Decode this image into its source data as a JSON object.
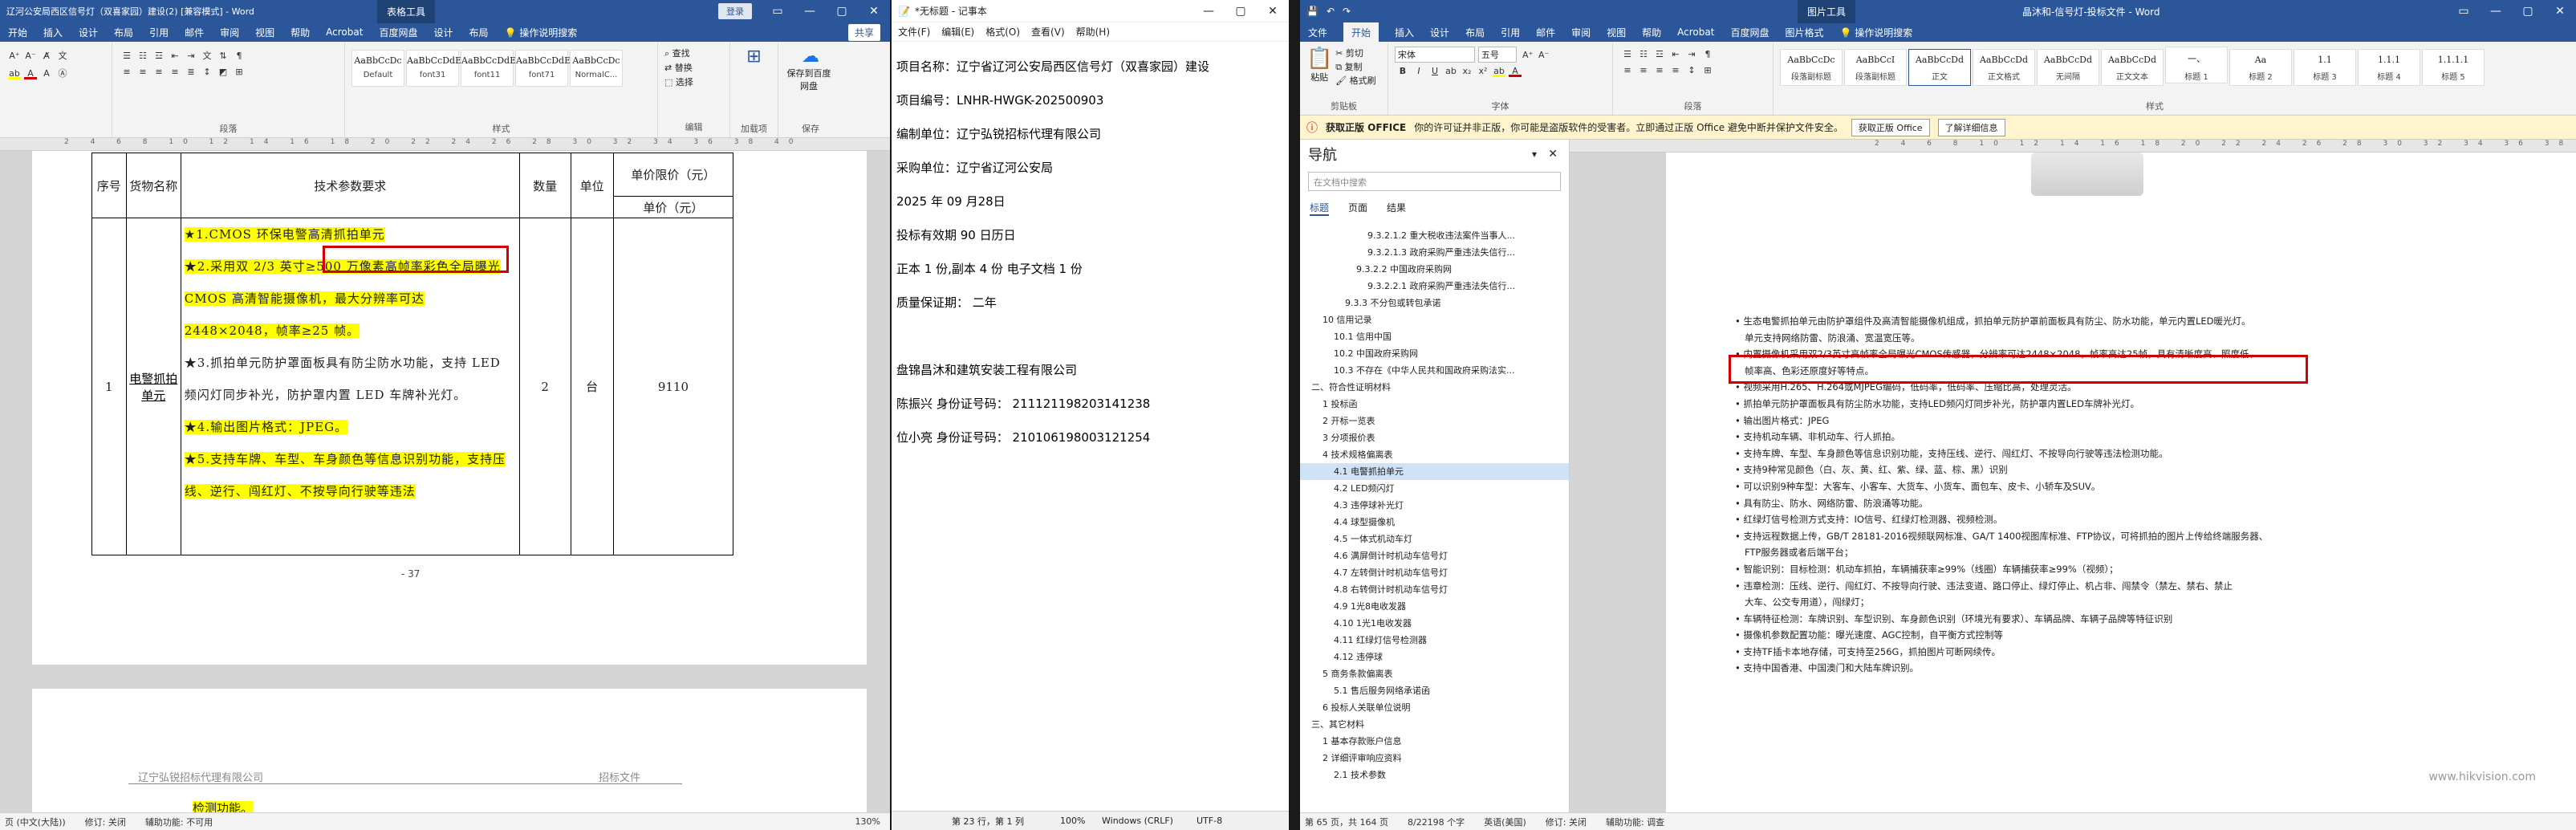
{
  "left_word": {
    "title": "辽河公安局西区信号灯（双喜家园）建设(2)  [兼容模式] - Word",
    "context_tab": "表格工具",
    "login": "登录",
    "tabs": [
      "开始",
      "插入",
      "设计",
      "布局",
      "引用",
      "邮件",
      "审阅",
      "视图",
      "帮助",
      "Acrobat",
      "百度网盘",
      "设计",
      "布局",
      "操作说明搜索"
    ],
    "ribbon_groups": [
      "段落",
      "样式",
      "编辑",
      "加载项",
      "保存"
    ],
    "styles": [
      {
        "preview": "AaBbCcDc",
        "name": "Default"
      },
      {
        "preview": "AaBbCcDdE",
        "name": "font31"
      },
      {
        "preview": "AaBbCcDdE",
        "name": "font11"
      },
      {
        "preview": "AaBbCcDdE",
        "name": "font71"
      },
      {
        "preview": "AaBbCcDc",
        "name": "NormalC..."
      }
    ],
    "edit_items": [
      "查找",
      "替换",
      "选择"
    ],
    "addins_label": "加载项",
    "save_label": "保存到百度网盘",
    "share": "共享",
    "table": {
      "headers": [
        "序号",
        "货物名称",
        "技术参数要求",
        "数量",
        "单位",
        "单价限价（元）",
        "单价（元）"
      ],
      "row_no": "1",
      "item_name": "电警抓拍单元",
      "qty": "2",
      "unit": "台",
      "price": "9110",
      "paras": [
        "★1.CMOS 环保电警高清抓拍单元",
        "★2.采用双 2/3 英寸≥500 万像素高帧率彩色全局曝光 CMOS 高清智能摄像机，最大分辨率可达 2448×2048，帧率≥25 帧。",
        "★3.抓拍单元防护罩面板具有防尘防水功能，支持 LED 频闪灯同步补光，防护罩内置 LED 车牌补光灯。",
        "★4.输出图片格式：JPEG。",
        "★5.支持车牌、车型、车身颜色等信息识别功能，支持压线、逆行、闯红灯、不按导向行驶等违法"
      ]
    },
    "page_number": "- 37",
    "header_company": "辽宁弘锐招标代理有限公司",
    "header_right": "招标文件",
    "bottom_text": "检测功能。",
    "status": {
      "pages": "页 (中文(大陆))",
      "revisions": "修订: 关闭",
      "accessibility": "辅助功能: 不可用",
      "zoom": "130%"
    }
  },
  "notepad": {
    "title": "*无标题 - 记事本",
    "menu": [
      "文件(F)",
      "编辑(E)",
      "格式(O)",
      "查看(V)",
      "帮助(H)"
    ],
    "lines": [
      "项目名称：辽宁省辽河公安局西区信号灯（双喜家园）建设",
      "项目编号：LNHR-HWGK-202500903",
      "编制单位：辽宁弘锐招标代理有限公司",
      "采购单位：辽宁省辽河公安局",
      "2025 年 09 月28日",
      "投标有效期 90 日历日",
      "正本 1 份,副本 4 份  电子文档  1  份",
      "质量保证期： 二年",
      "",
      "盘锦昌沐和建筑安装工程有限公司",
      "陈振兴  身份证号码：  211121198203141238",
      "位小亮  身份证号码：  210106198003121254"
    ],
    "status": {
      "pos": "第 23 行，第 1 列",
      "zoom": "100%",
      "eol": "Windows (CRLF)",
      "enc": "UTF-8"
    }
  },
  "right_word": {
    "title": "晶沐和-信号灯-投标文件 - Word",
    "context_tab": "图片工具",
    "tabs": [
      "文件",
      "开始",
      "插入",
      "设计",
      "布局",
      "引用",
      "邮件",
      "审阅",
      "视图",
      "帮助",
      "Acrobat",
      "百度网盘",
      "图片格式",
      "操作说明搜索"
    ],
    "active_tab": "开始",
    "font_name": "宋体",
    "font_size": "五号",
    "ribbon_groups": [
      "剪贴板",
      "字体",
      "段落",
      "样式"
    ],
    "clipboard_items": [
      "剪切",
      "复制",
      "格式刷"
    ],
    "paste": "粘贴",
    "styles": [
      {
        "preview": "AaBbCcDc",
        "name": "段落副标题"
      },
      {
        "preview": "AaBbCcI",
        "name": "段落副标题"
      },
      {
        "preview": "AaBbCcDd",
        "name": "正文"
      },
      {
        "preview": "AaBbCcDd",
        "name": "正文格式"
      },
      {
        "preview": "AaBbCcDd",
        "name": "无间隔"
      },
      {
        "preview": "AaBbCcDd",
        "name": "正文文本"
      },
      {
        "preview": "一、",
        "name": "标题 1"
      },
      {
        "preview": "Aa",
        "name": "标题 2"
      },
      {
        "preview": "1.1",
        "name": "标题 3"
      },
      {
        "preview": "1.1.1",
        "name": "标题 4"
      },
      {
        "preview": "1.1.1.1",
        "name": "标题 5"
      }
    ],
    "infobar": {
      "label": "获取正版 OFFICE",
      "text": "你的许可证并非正版，你可能是盗版软件的受害者。立即通过正版 Office 避免中断并保护文件安全。",
      "btn1": "获取正版 Office",
      "btn2": "了解详细信息"
    },
    "nav": {
      "title": "导航",
      "search_placeholder": "在文档中搜索",
      "tabs": [
        "标题",
        "页面",
        "结果"
      ],
      "items": [
        {
          "t": "9.3.2.1.2 重大税收违法案件当事人...",
          "l": 5
        },
        {
          "t": "9.3.2.1.3 政府采购严重违法失信行...",
          "l": 5
        },
        {
          "t": "9.3.2.2 中国政府采购网",
          "l": 4
        },
        {
          "t": "9.3.2.2.1 政府采购严重违法失信行...",
          "l": 5
        },
        {
          "t": "9.3.3 不分包或转包承诺",
          "l": 3
        },
        {
          "t": "10 信用记录",
          "l": 1
        },
        {
          "t": "10.1 信用中国",
          "l": 2
        },
        {
          "t": "10.2 中国政府采购网",
          "l": 2
        },
        {
          "t": "10.3 不存在《中华人民共和国政府采购法实...",
          "l": 2
        },
        {
          "t": "二、符合性证明材料",
          "l": 0
        },
        {
          "t": "1 投标函",
          "l": 1
        },
        {
          "t": "2 开标一览表",
          "l": 1
        },
        {
          "t": "3 分项报价表",
          "l": 1
        },
        {
          "t": "4 技术规格偏离表",
          "l": 1
        },
        {
          "t": "4.1 电警抓拍单元",
          "l": 2,
          "sel": true
        },
        {
          "t": "4.2 LED频闪灯",
          "l": 2
        },
        {
          "t": "4.3 违停球补光灯",
          "l": 2
        },
        {
          "t": "4.4 球型摄像机",
          "l": 2
        },
        {
          "t": "4.5 一体式机动车灯",
          "l": 2
        },
        {
          "t": "4.6 满屏倒计时机动车信号灯",
          "l": 2
        },
        {
          "t": "4.7 左转倒计时机动车信号灯",
          "l": 2
        },
        {
          "t": "4.8 右转倒计时机动车信号灯",
          "l": 2
        },
        {
          "t": "4.9 1光8电收发器",
          "l": 2
        },
        {
          "t": "4.10 1光1电收发器",
          "l": 2
        },
        {
          "t": "4.11 红绿灯信号检测器",
          "l": 2
        },
        {
          "t": "4.12 违停球",
          "l": 2
        },
        {
          "t": "5 商务条款偏离表",
          "l": 1
        },
        {
          "t": "5.1 售后服务网络承诺函",
          "l": 2
        },
        {
          "t": "6 投标人关联单位说明",
          "l": 1
        },
        {
          "t": "三、其它材料",
          "l": 0
        },
        {
          "t": "1 基本存款账户信息",
          "l": 1
        },
        {
          "t": "2 详细评审响应资料",
          "l": 1
        },
        {
          "t": "2.1 技术参数",
          "l": 2
        }
      ]
    },
    "doc_lines": [
      "生态电警抓拍单元由防护罩组件及高清智能摄像机组成，抓拍单元防护罩前面板具有防尘、防水功能，单元内置LED暖光灯。",
      "单元支持网络防雷、防浪涌、宽温宽压等。",
      "内置摄像机采用双2/3英寸高帧率全局曝光CMOS传感器，分辨率可达2448×2048，帧率高达25帧，具有清晰度高、照度低、",
      "帧率高、色彩还原度好等特点。",
      "视频采用H.265、H.264或MJPEG编码，低码率，低码率、压缩比高，处理灵活。",
      "抓拍单元防护罩面板具有防尘防水功能，支持LED频闪灯同步补光，防护罩内置LED车牌补光灯。",
      "输出图片格式：JPEG",
      "支持机动车辆、非机动车、行人抓拍。",
      "支持车牌、车型、车身颜色等信息识别功能，支持压线、逆行、闯红灯、不按导向行驶等违法检测功能。",
      "支持9种常见颜色（白、灰、黄、红、紫、绿、蓝、棕、黑）识别",
      "可以识别9种车型：大客车、小客车、大货车、小货车、面包车、皮卡、小轿车及SUV。",
      "具有防尘、防水、网络防雷、防浪涌等功能。",
      "红绿灯信号检测方式支持：IO信号、红绿灯检测器、视频检测。",
      "支持远程数据上传，GB/T 28181-2016视频联网标准、GA/T 1400视图库标准、FTP协议，可将抓拍的图片上传给终端服务器、",
      "FTP服务器或者后端平台；",
      "智能识别：目标检测：机动车抓拍，车辆捕获率≥99%（线圈）车辆捕获率≥99%（视频）；",
      "违章检测：压线、逆行、闯红灯、不按导向行驶、违法变道、路口停止、绿灯停止、机占非、闯禁令（禁左、禁右、禁止",
      "大车、公交专用道），闯绿灯；",
      "车辆特征检测：车牌识别、车型识别、车身颜色识别（环境光有要求）、车辆品牌、车辆子品牌等特征识别",
      "摄像机参数配置功能：曝光速度、AGC控制，自平衡方式控制等",
      "支持TF插卡本地存储，可支持至256G，抓拍图片可断网续传。",
      "支持中国香港、中国澳门和大陆车牌识别。"
    ],
    "watermark": "www.hikvision.com",
    "status": {
      "page": "第 65 页，共 164 页",
      "words": "8/22198 个字",
      "lang": "英语(美国)",
      "revisions": "修订: 关闭",
      "accessibility": "辅助功能: 调查"
    }
  }
}
